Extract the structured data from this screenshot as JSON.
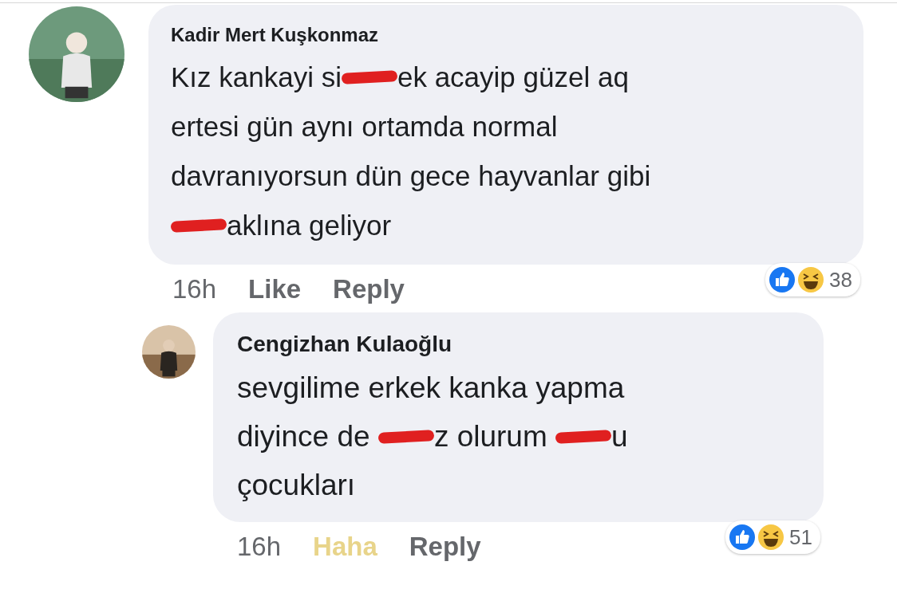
{
  "comments": [
    {
      "author": "Kadir Mert Kuşkonmaz",
      "kind": "comment",
      "lines": [
        [
          {
            "kind": "text",
            "text": "Kız kankayi si"
          },
          {
            "kind": "redacted"
          },
          {
            "kind": "text",
            "text": "ek acayip güzel aq"
          }
        ],
        [
          {
            "kind": "text",
            "text": "ertesi gün aynı ortamda normal"
          }
        ],
        [
          {
            "kind": "text",
            "text": "davranıyorsun dün gece hayvanlar gibi"
          }
        ],
        [
          {
            "kind": "redacted"
          },
          {
            "kind": "text",
            "text": "aklına geliyor"
          }
        ]
      ],
      "time": "16h",
      "reaction": {
        "label": "Like",
        "active": false
      },
      "reply": "Reply",
      "reaction_count": "38"
    },
    {
      "author": "Cengizhan Kulaoğlu",
      "kind": "reply",
      "lines": [
        [
          {
            "kind": "text",
            "text": "sevgilime erkek kanka yapma"
          }
        ],
        [
          {
            "kind": "text",
            "text": "diyince de "
          },
          {
            "kind": "redacted"
          },
          {
            "kind": "text",
            "text": "z olurum "
          },
          {
            "kind": "redacted"
          },
          {
            "kind": "text",
            "text": "u"
          }
        ],
        [
          {
            "kind": "text",
            "text": "çocukları"
          }
        ]
      ],
      "time": "16h",
      "reaction": {
        "label": "Haha",
        "active": true
      },
      "reply": "Reply",
      "reaction_count": "51"
    }
  ]
}
